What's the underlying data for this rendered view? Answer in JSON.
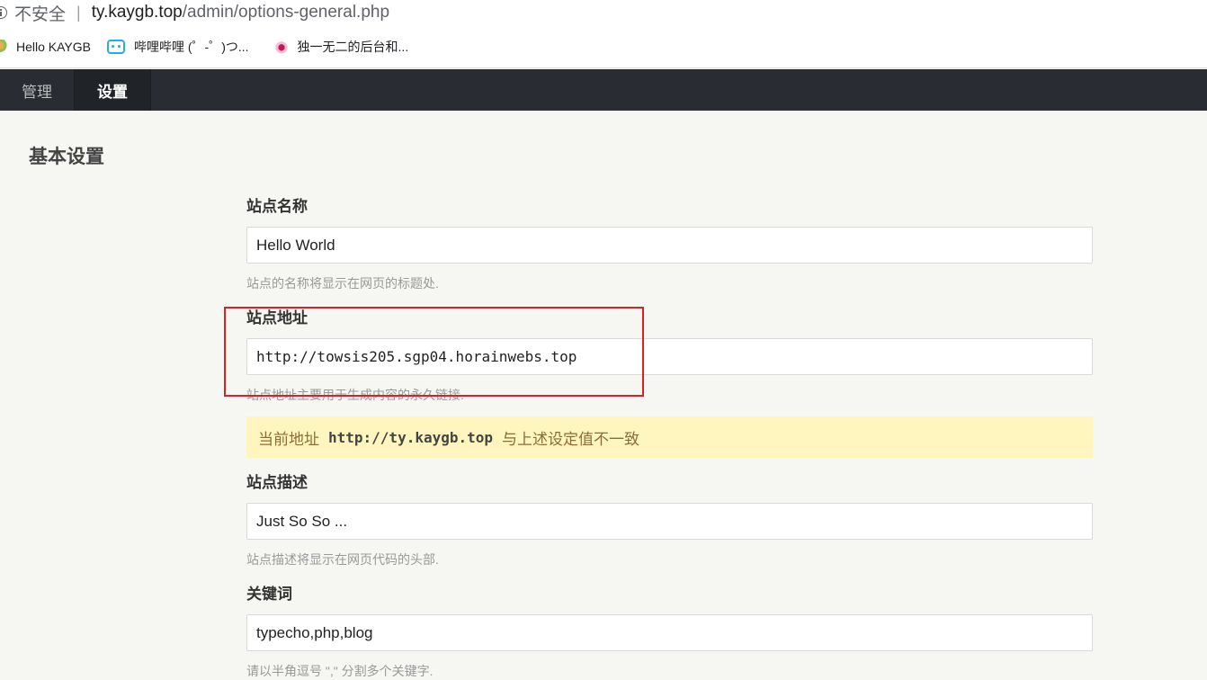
{
  "browser": {
    "security_label": "不安全",
    "separator": "|",
    "url_host": "ty.kaygb.top",
    "url_path": "/admin/options-general.php"
  },
  "bookmarks": [
    {
      "label": "Hello KAYGB",
      "icon": "kaygb-favicon"
    },
    {
      "label": "哔哩哔哩 (゜-゜)つ...",
      "icon": "bilibili-icon"
    },
    {
      "label": "独一无二的后台和...",
      "icon": "site-favicon"
    }
  ],
  "nav": {
    "items": [
      {
        "label": "管理",
        "active": false
      },
      {
        "label": "设置",
        "active": true
      }
    ]
  },
  "page": {
    "title": "基本设置"
  },
  "form": {
    "site_name": {
      "label": "站点名称",
      "value": "Hello World",
      "description": "站点的名称将显示在网页的标题处."
    },
    "site_url": {
      "label": "站点地址",
      "value": "http://towsis205.sgp04.horainwebs.top",
      "description": "站点地址主要用于生成内容的永久链接."
    },
    "notice": {
      "prefix": "当前地址",
      "url": "http://ty.kaygb.top",
      "suffix": "与上述设定值不一致"
    },
    "site_desc": {
      "label": "站点描述",
      "value": "Just So So ...",
      "description": "站点描述将显示在网页代码的头部."
    },
    "keywords": {
      "label": "关键词",
      "value": "typecho,php,blog",
      "description": "请以半角逗号 \",\" 分割多个关键字."
    }
  },
  "colors": {
    "nav_bg": "#292d33",
    "notice_bg": "#fff6bf",
    "highlight_box": "#e02020"
  }
}
